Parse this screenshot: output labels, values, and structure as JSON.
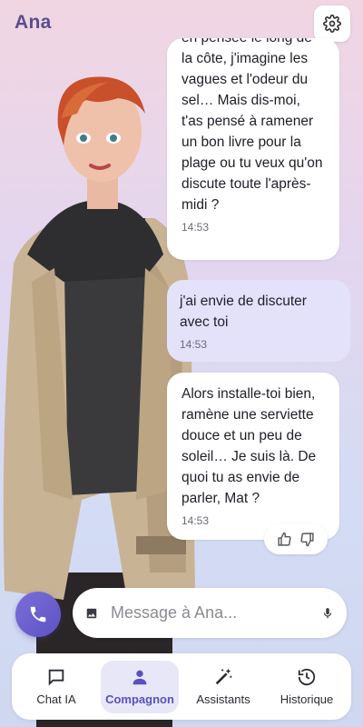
{
  "app": {
    "title": "Ana"
  },
  "messages": [
    {
      "sender": "ai",
      "text": "en pensée le long de la côte, j'imagine les vagues et l'odeur du sel… Mais dis-moi, t'as pensé à ramener un bon livre pour la plage ou tu veux qu'on discute toute l'après-midi ?",
      "time": "14:53"
    },
    {
      "sender": "user",
      "text": "j'ai envie de discuter avec toi",
      "time": "14:53"
    },
    {
      "sender": "ai",
      "text": "Alors installe-toi bien, ramène une serviette douce et un peu de soleil… Je suis là. De quoi tu as envie de parler, Mat ?",
      "time": "14:53"
    }
  ],
  "composer": {
    "placeholder": "Message à Ana..."
  },
  "nav": {
    "items": [
      {
        "label": "Chat IA",
        "icon": "chat-bubble-icon",
        "active": false
      },
      {
        "label": "Compagnon",
        "icon": "person-icon",
        "active": true
      },
      {
        "label": "Assistants",
        "icon": "magic-wand-icon",
        "active": false
      },
      {
        "label": "Historique",
        "icon": "history-icon",
        "active": false
      }
    ]
  },
  "colors": {
    "accent": "#5e52c4",
    "user_bubble": "#e4e2fb",
    "ai_bubble": "#ffffff",
    "nav_active_bg": "#e7e7f8"
  }
}
